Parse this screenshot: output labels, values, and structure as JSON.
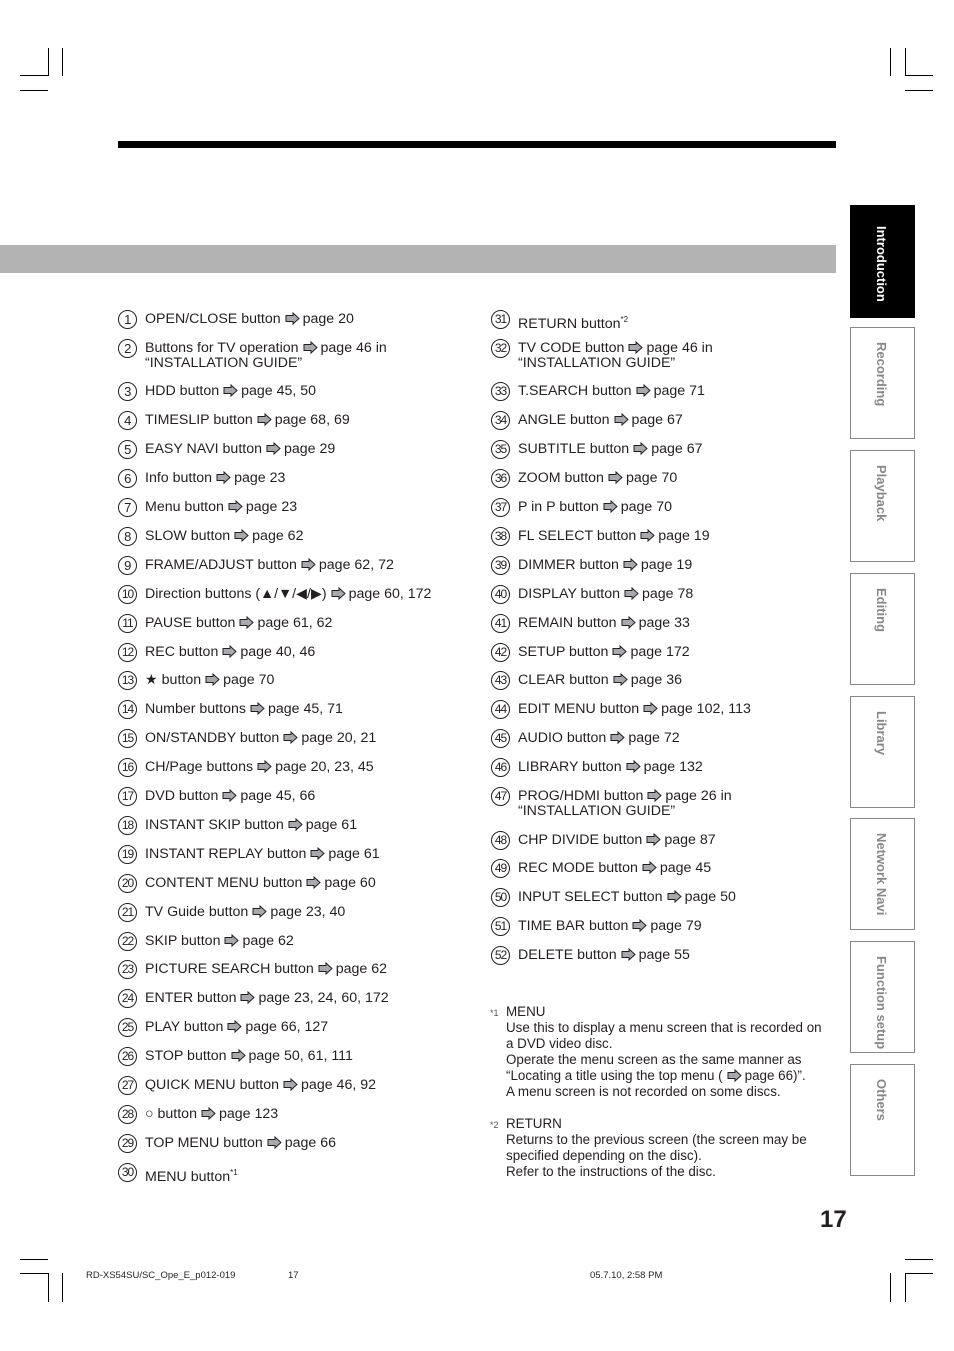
{
  "left_items": [
    {
      "n": "1",
      "text": "OPEN/CLOSE button",
      "ref": "page 20"
    },
    {
      "n": "2",
      "text": "Buttons for TV operation",
      "ref": "page 46 in",
      "ref2": "“INSTALLATION GUIDE”"
    },
    {
      "n": "3",
      "text": "HDD button",
      "ref": "page 45, 50"
    },
    {
      "n": "4",
      "text": "TIMESLIP button",
      "ref": "page 68, 69"
    },
    {
      "n": "5",
      "text": "EASY NAVI button",
      "ref": "page 29"
    },
    {
      "n": "6",
      "text": "Info button",
      "ref": "page 23"
    },
    {
      "n": "7",
      "text": "Menu button",
      "ref": "page 23"
    },
    {
      "n": "8",
      "text": "SLOW button",
      "ref": "page 62"
    },
    {
      "n": "9",
      "text": "FRAME/ADJUST button",
      "ref": "page 62, 72"
    },
    {
      "n": "10",
      "text": "Direction buttons (▲/▼/◀/▶)",
      "ref": "page 60, 172"
    },
    {
      "n": "11",
      "text": "PAUSE button",
      "ref": "page 61, 62"
    },
    {
      "n": "12",
      "text": "REC button",
      "ref": "page 40, 46"
    },
    {
      "n": "13",
      "text": "★ button",
      "ref": "page 70"
    },
    {
      "n": "14",
      "text": "Number buttons",
      "ref": "page 45, 71"
    },
    {
      "n": "15",
      "text": "ON/STANDBY button",
      "ref": "page 20, 21"
    },
    {
      "n": "16",
      "text": "CH/Page buttons",
      "ref": "page 20, 23, 45"
    },
    {
      "n": "17",
      "text": "DVD button",
      "ref": "page 45, 66"
    },
    {
      "n": "18",
      "text": "INSTANT SKIP button",
      "ref": "page 61"
    },
    {
      "n": "19",
      "text": "INSTANT REPLAY button",
      "ref": "page 61"
    },
    {
      "n": "20",
      "text": "CONTENT MENU button",
      "ref": "page 60"
    },
    {
      "n": "21",
      "text": "TV Guide button",
      "ref": "page 23, 40"
    },
    {
      "n": "22",
      "text": "SKIP button",
      "ref": "page 62"
    },
    {
      "n": "23",
      "text": "PICTURE SEARCH button",
      "ref": "page 62"
    },
    {
      "n": "24",
      "text": "ENTER button",
      "ref": "page 23, 24, 60, 172"
    },
    {
      "n": "25",
      "text": "PLAY button",
      "ref": "page 66, 127"
    },
    {
      "n": "26",
      "text": "STOP button",
      "ref": "page 50, 61, 111"
    },
    {
      "n": "27",
      "text": "QUICK MENU button",
      "ref": "page 46, 92"
    },
    {
      "n": "28",
      "text": "○ button",
      "ref": "page 123"
    },
    {
      "n": "29",
      "text": "TOP MENU button",
      "ref": "page 66"
    },
    {
      "n": "30",
      "text": "MENU button",
      "sup": "*1"
    }
  ],
  "right_items": [
    {
      "n": "31",
      "text": "RETURN button",
      "sup": "*2"
    },
    {
      "n": "32",
      "text": "TV CODE button",
      "ref": "page 46 in",
      "ref2": "“INSTALLATION GUIDE”"
    },
    {
      "n": "33",
      "text": "T.SEARCH button",
      "ref": "page 71"
    },
    {
      "n": "34",
      "text": "ANGLE button",
      "ref": "page 67"
    },
    {
      "n": "35",
      "text": "SUBTITLE button",
      "ref": "page 67"
    },
    {
      "n": "36",
      "text": "ZOOM button",
      "ref": "page 70"
    },
    {
      "n": "37",
      "text": "P in P button",
      "ref": "page 70"
    },
    {
      "n": "38",
      "text": "FL SELECT button",
      "ref": "page 19"
    },
    {
      "n": "39",
      "text": "DIMMER button",
      "ref": "page 19"
    },
    {
      "n": "40",
      "text": "DISPLAY button",
      "ref": "page 78"
    },
    {
      "n": "41",
      "text": "REMAIN button",
      "ref": "page 33"
    },
    {
      "n": "42",
      "text": "SETUP button",
      "ref": "page 172"
    },
    {
      "n": "43",
      "text": "CLEAR button",
      "ref": "page 36"
    },
    {
      "n": "44",
      "text": "EDIT MENU button",
      "ref": "page 102, 113"
    },
    {
      "n": "45",
      "text": "AUDIO button",
      "ref": "page 72"
    },
    {
      "n": "46",
      "text": "LIBRARY button",
      "ref": "page 132"
    },
    {
      "n": "47",
      "text": "PROG/HDMI button",
      "ref": "page 26 in",
      "ref2": "“INSTALLATION GUIDE”"
    },
    {
      "n": "48",
      "text": "CHP DIVIDE button",
      "ref": "page 87"
    },
    {
      "n": "49",
      "text": "REC MODE button",
      "ref": "page 45"
    },
    {
      "n": "50",
      "text": "INPUT SELECT button",
      "ref": "page 50"
    },
    {
      "n": "51",
      "text": "TIME BAR button",
      "ref": "page 79"
    },
    {
      "n": "52",
      "text": "DELETE button",
      "ref": "page 55"
    }
  ],
  "notes": {
    "n1": {
      "mark": "*1",
      "title": "MENU",
      "l1": "Use this to display a menu screen that is recorded on",
      "l2": "a DVD video disc.",
      "l3": "Operate the menu screen as the same manner as",
      "l4a": "“Locating a title using the top menu (",
      "l4b": "page 66)”.",
      "l5": "A menu screen is not recorded on some discs."
    },
    "n2": {
      "mark": "*2",
      "title": "RETURN",
      "l1": "Returns to the previous screen (the screen may be",
      "l2": "specified depending on the disc).",
      "l3": "Refer to the instructions of the disc."
    }
  },
  "tabs": [
    "Introduction",
    "Recording",
    "Playback",
    "Editing",
    "Library",
    "Network Navi",
    "Function setup",
    "Others"
  ],
  "active_tab": "Introduction",
  "page_number": "17",
  "footer": {
    "file": "RD-XS54SU/SC_Ope_E_p012-019",
    "page": "17",
    "date": "05.7.10, 2:58 PM"
  },
  "colors": {
    "tab_active_bg": "#000000",
    "tab_inactive_text": "#888888",
    "band_gray": "#b3b3b3",
    "arrow_fill": "#a7a9ac"
  }
}
